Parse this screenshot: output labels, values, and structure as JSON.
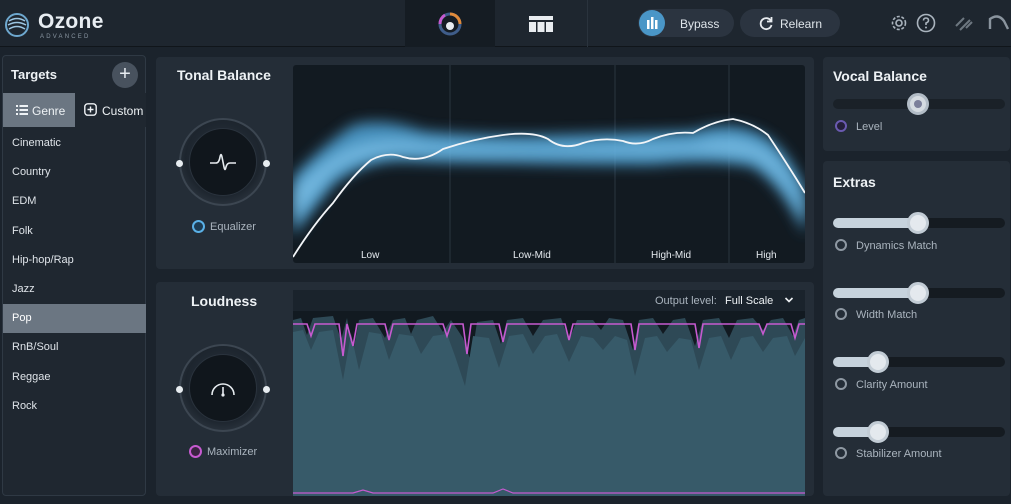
{
  "app": {
    "name": "Ozone",
    "edition": "ADVANCED"
  },
  "toolbar": {
    "bypass_label": "Bypass",
    "relearn_label": "Relearn"
  },
  "targets": {
    "title": "Targets",
    "tabs": [
      {
        "label": "Genre",
        "selected": true
      },
      {
        "label": "Custom",
        "selected": false
      }
    ],
    "genres": [
      "Cinematic",
      "Country",
      "EDM",
      "Folk",
      "Hip-hop/Rap",
      "Jazz",
      "Pop",
      "RnB/Soul",
      "Reggae",
      "Rock"
    ],
    "selected": "Pop"
  },
  "tonal_balance": {
    "title": "Tonal Balance",
    "module_label": "Equalizer",
    "bands": [
      "Low",
      "Low-Mid",
      "High-Mid",
      "High"
    ]
  },
  "loudness": {
    "title": "Loudness",
    "module_label": "Maximizer",
    "output_label": "Output level:",
    "output_value": "Full Scale"
  },
  "vocal_balance": {
    "title": "Vocal Balance",
    "slider": {
      "label": "Level",
      "value": 0.5
    }
  },
  "extras": {
    "title": "Extras",
    "sliders": [
      {
        "label": "Dynamics Match",
        "value": 0.5
      },
      {
        "label": "Width Match",
        "value": 0.5
      },
      {
        "label": "Clarity Amount",
        "value": 0.27
      },
      {
        "label": "Stabilizer Amount",
        "value": 0.27
      }
    ]
  },
  "colors": {
    "accent_blue": "#4a96c7",
    "maximizer_pink": "#c65ad0",
    "equalizer_blue": "#5ab0e6"
  }
}
